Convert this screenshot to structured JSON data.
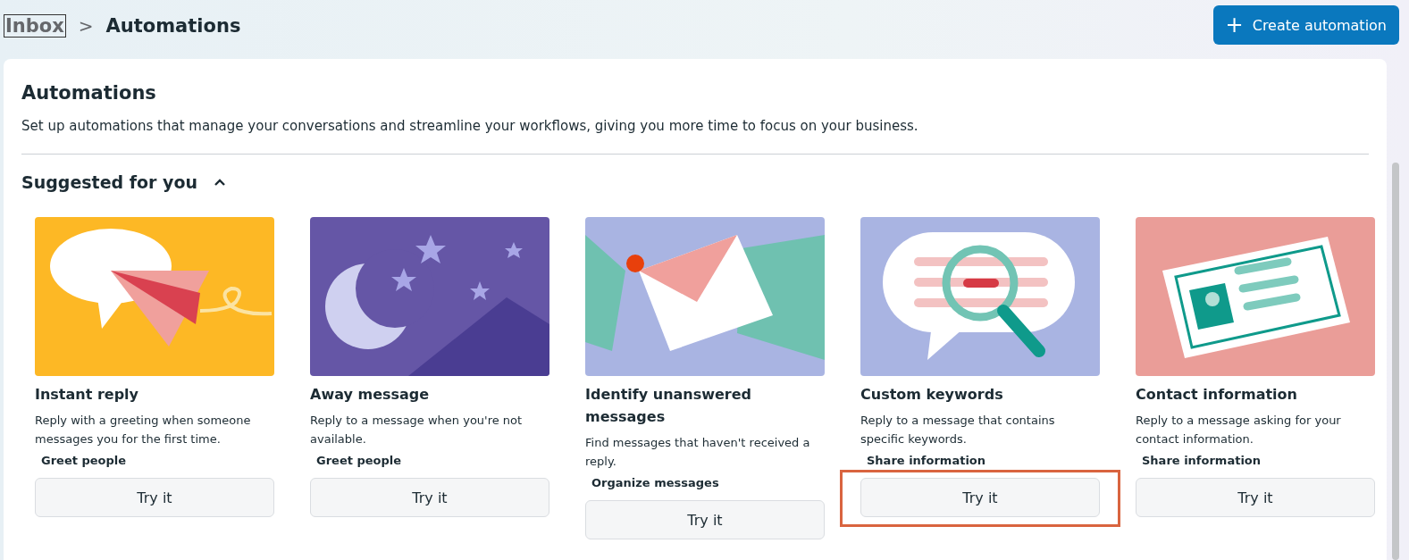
{
  "breadcrumb": {
    "parent": "Inbox",
    "separator": ">",
    "current": "Automations"
  },
  "create_button": {
    "icon": "+",
    "label": "Create automation"
  },
  "panel": {
    "title": "Automations",
    "description": "Set up automations that manage your conversations and streamline your workflows, giving you more time to focus on your business."
  },
  "section": {
    "title": "Suggested for you",
    "expanded": true
  },
  "cards": [
    {
      "kind": "paper-plane",
      "title": "Instant reply",
      "description": "Reply with a greeting when someone messages you for the first time.",
      "tag": "Greet people",
      "button": "Try it",
      "highlighted": false
    },
    {
      "kind": "moon",
      "title": "Away message",
      "description": "Reply to a message when you're not available.",
      "tag": "Greet people",
      "button": "Try it",
      "highlighted": false
    },
    {
      "kind": "envelopes",
      "title": "Identify unanswered messages",
      "description": "Find messages that haven't received a reply.",
      "tag": "Organize messages",
      "button": "Try it",
      "highlighted": false
    },
    {
      "kind": "magnifier",
      "title": "Custom keywords",
      "description": "Reply to a message that contains specific keywords.",
      "tag": "Share information",
      "button": "Try it",
      "highlighted": true
    },
    {
      "kind": "contact-card",
      "title": "Contact information",
      "description": "Reply to a message asking for your contact information.",
      "tag": "Share information",
      "button": "Try it",
      "highlighted": false
    }
  ]
}
